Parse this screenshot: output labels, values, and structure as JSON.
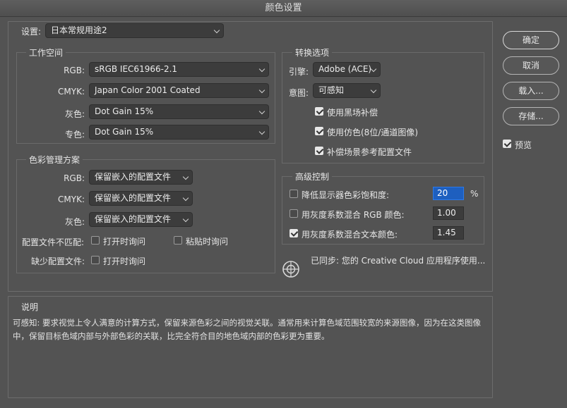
{
  "window": {
    "title": "颜色设置"
  },
  "settings": {
    "label": "设置:",
    "value": "日本常规用途2"
  },
  "working_spaces": {
    "title": "工作空间",
    "rgb": {
      "label": "RGB:",
      "value": "sRGB IEC61966-2.1"
    },
    "cmyk": {
      "label": "CMYK:",
      "value": "Japan Color 2001 Coated"
    },
    "gray": {
      "label": "灰色:",
      "value": "Dot Gain 15%"
    },
    "spot": {
      "label": "专色:",
      "value": "Dot Gain 15%"
    }
  },
  "color_management": {
    "title": "色彩管理方案",
    "rgb": {
      "label": "RGB:",
      "value": "保留嵌入的配置文件"
    },
    "cmyk": {
      "label": "CMYK:",
      "value": "保留嵌入的配置文件"
    },
    "gray": {
      "label": "灰色:",
      "value": "保留嵌入的配置文件"
    },
    "mismatch": {
      "label": "配置文件不匹配:",
      "ask_open": "打开时询问",
      "ask_paste": "粘贴时询问"
    },
    "missing": {
      "label": "缺少配置文件:",
      "ask_open": "打开时询问"
    }
  },
  "conversion": {
    "title": "转换选项",
    "engine": {
      "label": "引擎:",
      "value": "Adobe (ACE)"
    },
    "intent": {
      "label": "意图:",
      "value": "可感知"
    },
    "bpc": {
      "label": "使用黑场补偿",
      "checked": true
    },
    "dither": {
      "label": "使用仿色(8位/通道图像)",
      "checked": true
    },
    "scene": {
      "label": "补偿场景参考配置文件",
      "checked": true
    }
  },
  "advanced": {
    "title": "高级控制",
    "desaturate": {
      "label": "降低显示器色彩饱和度:",
      "value": "20",
      "unit": "%",
      "checked": false
    },
    "blend_rgb": {
      "label": "用灰度系数混合 RGB 颜色:",
      "value": "1.00",
      "checked": false
    },
    "blend_text": {
      "label": "用灰度系数混合文本颜色:",
      "value": "1.45",
      "checked": true
    }
  },
  "sync": {
    "text": "已同步: 您的 Creative Cloud 应用程序使用..."
  },
  "description": {
    "title": "说明",
    "text": "可感知: 要求视觉上令人满意的计算方式，保留来源色彩之间的视觉关联。通常用来计算色域范围较宽的来源图像，因为在这类图像中，保留目标色域内部与外部色彩的关联，比完全符合目的地色域内部的色彩更为重要。"
  },
  "buttons": {
    "ok": "确定",
    "cancel": "取消",
    "load": "载入...",
    "save": "存储..."
  },
  "preview": {
    "label": "预览",
    "checked": true
  }
}
